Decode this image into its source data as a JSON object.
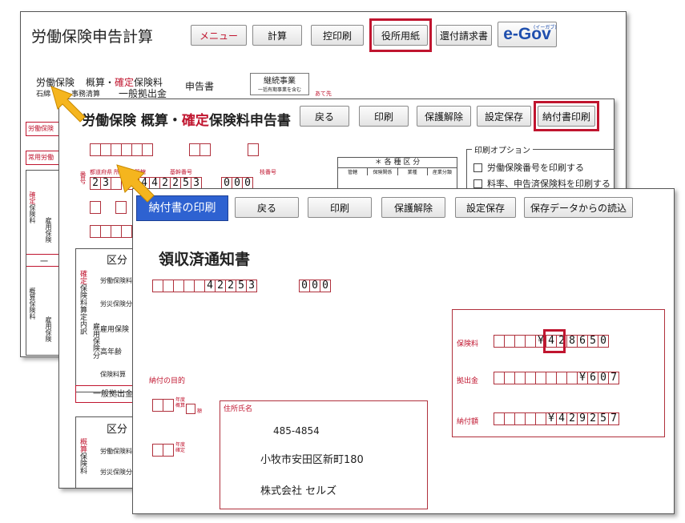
{
  "win1": {
    "title": "労働保険申告計算",
    "buttons": [
      "メニュー",
      "計算",
      "控印刷",
      "役所用紙",
      "還付請求書"
    ],
    "egov_logo": "e-Gov",
    "egov_ruby": "(イーガブ)",
    "form_line1a": "労働保険",
    "form_line1b": "概算・",
    "form_line1c": "確定",
    "form_line1d": "保険料",
    "form_line1e": "申告書",
    "form_line2a": "石綿",
    "form_line2b": "事務清算",
    "form_line2c": "一般拠出金",
    "keizoku": "継続事業",
    "keizoku_sub": "一括有期事業を含む",
    "atesaki": "あて先",
    "side1": "労働保険",
    "side2": "常用労働",
    "dash": "一",
    "v1a": "確",
    "v1b": "定",
    "v1c": "保険料",
    "v2": "雇用保険",
    "v3": "概算保険料",
    "v4": "雇用保険"
  },
  "win2": {
    "title_a": "労働保険 概算・",
    "title_b": "確定",
    "title_c": "保険料申告書",
    "buttons": [
      "戻る",
      "印刷",
      "保護解除",
      "設定保存",
      "納付書印刷"
    ],
    "print_option_title": "印刷オプション",
    "option1": "労働保険番号を印刷する",
    "option2": "料率、申告済保険料を印刷する",
    "kubun_header": "＊ 各 種 区 分",
    "kubun_cols": [
      "管轄",
      "保険関係",
      "業種",
      "産業分類"
    ],
    "num_label": "番号",
    "num_headers": [
      "都道府県",
      "所掌",
      "管轄",
      "基幹番号",
      "枝番号"
    ],
    "num_digits": [
      "2",
      "3",
      "",
      "1",
      "4",
      "4",
      "2",
      "2",
      "5",
      "3",
      "",
      "0",
      "0",
      "0"
    ],
    "kubun": "区分",
    "rows": [
      "労働保険料",
      "労災保険分",
      "雇用保険",
      "高年齢",
      "保険料算"
    ],
    "v_kakutei": "確定",
    "v_kakutei_rest": "保険料算定内訳",
    "v_koyou": "雇用保険分",
    "ippan": "一般拠出金",
    "kubun2": "区分",
    "rows2": [
      "労働保険料",
      "労災保険分"
    ],
    "v_gaisan": "概算",
    "v_gaisan_rest": "保険料"
  },
  "win3": {
    "title": "納付書の印刷",
    "buttons": [
      "戻る",
      "印刷",
      "保護解除",
      "設定保存",
      "保存データからの読込"
    ],
    "heading": "領収済通知書",
    "code_digits": [
      "",
      "",
      "",
      "",
      "",
      "4",
      "2",
      "2",
      "5",
      "3"
    ],
    "code_branch": [
      "0",
      "0",
      "0"
    ],
    "hokenryo_label": "保険料",
    "hokenryo_digits": [
      "",
      "",
      "",
      "",
      "¥",
      "4",
      "2",
      "8",
      "6",
      "5",
      "0"
    ],
    "kyoshutsu_label": "拠出金",
    "kyoshutsu_digits": [
      "",
      "",
      "",
      "",
      "",
      "",
      "",
      "",
      "¥",
      "6",
      "0",
      "7"
    ],
    "nofu_label": "納付額",
    "nofu_digits": [
      "",
      "",
      "",
      "",
      "",
      "¥",
      "4",
      "2",
      "9",
      "2",
      "5",
      "7"
    ],
    "purpose": "納付の目的",
    "nendo_gaisan": "年度概算",
    "nendo_mark": "額",
    "nendo_kakutei": "年度確定",
    "address_label": "住所氏名",
    "postal": "485-4854",
    "address": "小牧市安田区新町180",
    "company": "株式会社 セルズ"
  },
  "colors": {
    "accent_red": "#c0152f",
    "title_blue": "#2e62d1",
    "arrow": "#f5b51e"
  }
}
